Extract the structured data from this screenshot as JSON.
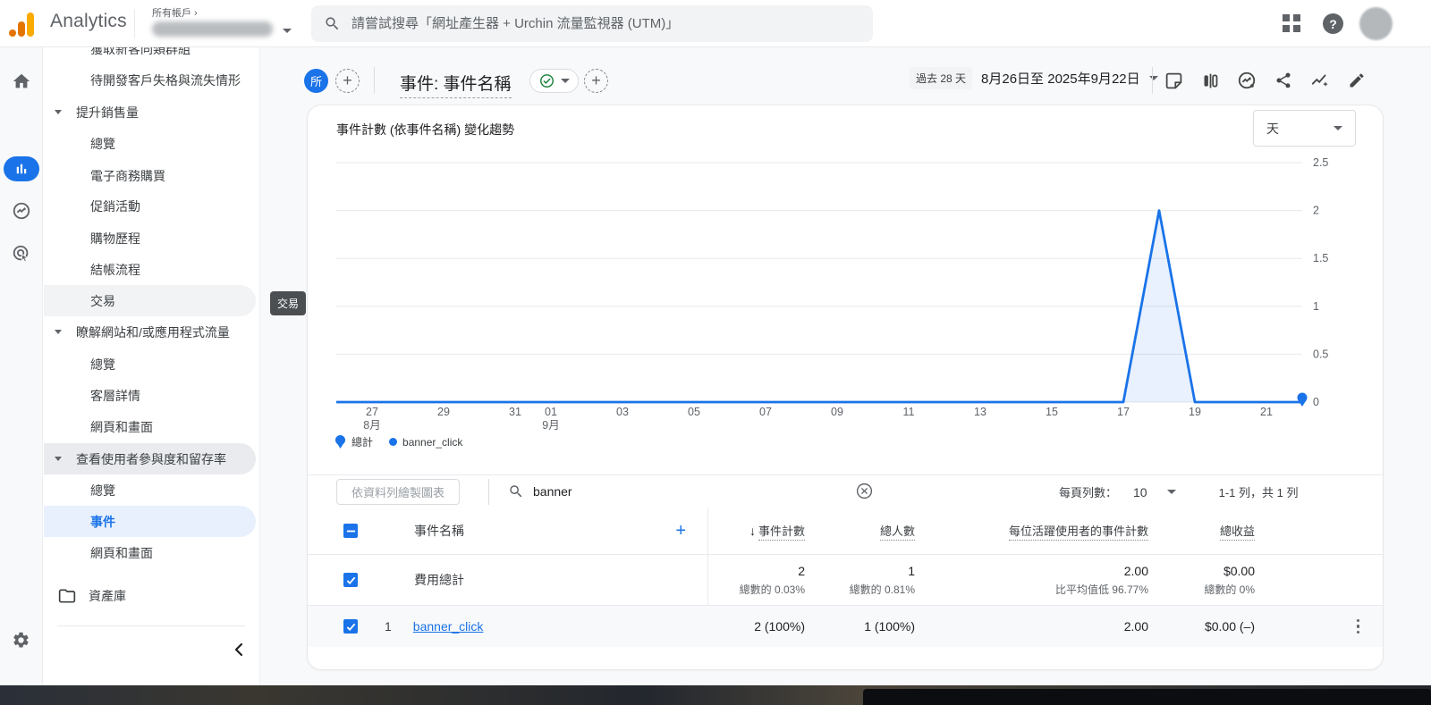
{
  "topbar": {
    "brand": "Analytics",
    "account_breadcrumb": "所有帳戶 ›",
    "search_placeholder": "請嘗試搜尋「網址產生器 + Urchin 流量監視器 (UTM)」",
    "help_glyph": "?"
  },
  "sidebar": {
    "items": [
      {
        "label": "獲取新客同類群組",
        "type": "child"
      },
      {
        "label": "待開發客戶失格與流失情形",
        "type": "child"
      },
      {
        "label": "提升銷售量",
        "type": "group"
      },
      {
        "label": "總覽",
        "type": "child"
      },
      {
        "label": "電子商務購買",
        "type": "child"
      },
      {
        "label": "促銷活動",
        "type": "child"
      },
      {
        "label": "購物歷程",
        "type": "child"
      },
      {
        "label": "結帳流程",
        "type": "child"
      },
      {
        "label": "交易",
        "type": "child",
        "state": "hover"
      },
      {
        "label": "瞭解網站和/或應用程式流量",
        "type": "group"
      },
      {
        "label": "總覽",
        "type": "child"
      },
      {
        "label": "客層詳情",
        "type": "child"
      },
      {
        "label": "網頁和畫面",
        "type": "child"
      },
      {
        "label": "查看使用者參與度和留存率",
        "type": "group",
        "state": "highlight"
      },
      {
        "label": "總覽",
        "type": "child"
      },
      {
        "label": "事件",
        "type": "child",
        "state": "selected"
      },
      {
        "label": "網頁和畫面",
        "type": "child"
      }
    ],
    "library_label": "資產庫",
    "tooltip": "交易"
  },
  "report_header": {
    "segment_chip": "所",
    "add_chip": "+",
    "title": "事件: 事件名稱",
    "date_range_badge": "過去 28 天",
    "date_range": "8月26日至 2025年9月22日"
  },
  "chart": {
    "title": "事件計數 (依事件名稱) 變化趨勢",
    "interval": "天",
    "legend_total": "總計",
    "legend_series": "banner_click"
  },
  "chart_data": {
    "type": "line",
    "title": "事件計數 (依事件名稱) 變化趨勢",
    "interval": "天",
    "x": [
      "8/26",
      "8/27",
      "8/28",
      "8/29",
      "8/30",
      "8/31",
      "9/01",
      "9/02",
      "9/03",
      "9/04",
      "9/05",
      "9/06",
      "9/07",
      "9/08",
      "9/09",
      "9/10",
      "9/11",
      "9/12",
      "9/13",
      "9/14",
      "9/15",
      "9/16",
      "9/17",
      "9/18",
      "9/19",
      "9/20",
      "9/21",
      "9/22"
    ],
    "series": [
      {
        "name": "banner_click",
        "color": "#1a73e8",
        "values": [
          0,
          0,
          0,
          0,
          0,
          0,
          0,
          0,
          0,
          0,
          0,
          0,
          0,
          0,
          0,
          0,
          0,
          0,
          0,
          0,
          0,
          0,
          0,
          2,
          0,
          0,
          0,
          0
        ]
      }
    ],
    "ylim": [
      0,
      2.5
    ],
    "yticks": [
      2.5,
      2,
      1.5,
      1,
      0.5,
      0
    ],
    "x_ticks": [
      {
        "i": 1,
        "label": "27",
        "month": "8月"
      },
      {
        "i": 3,
        "label": "29"
      },
      {
        "i": 5,
        "label": "31"
      },
      {
        "i": 6,
        "label": "01",
        "month": "9月"
      },
      {
        "i": 8,
        "label": "03"
      },
      {
        "i": 10,
        "label": "05"
      },
      {
        "i": 12,
        "label": "07"
      },
      {
        "i": 14,
        "label": "09"
      },
      {
        "i": 16,
        "label": "11"
      },
      {
        "i": 18,
        "label": "13"
      },
      {
        "i": 20,
        "label": "15"
      },
      {
        "i": 22,
        "label": "17"
      },
      {
        "i": 24,
        "label": "19"
      },
      {
        "i": 26,
        "label": "21"
      }
    ],
    "grid": true,
    "legend": [
      "總計",
      "banner_click"
    ],
    "legend_position": "bottom"
  },
  "table": {
    "plot_rows_button": "依資料列繪製圖表",
    "search_value": "banner",
    "rows_per_page_label": "每頁列數：",
    "rows_per_page": "10",
    "pagination": "1-1 列，共 1 列",
    "columns": {
      "dimension": "事件名稱",
      "metric1": "事件計數",
      "metric2": "總人數",
      "metric3": "每位活躍使用者的事件計數",
      "metric4": "總收益"
    },
    "sort_arrow": "↓",
    "totals": {
      "label": "費用總計",
      "event_count": "2",
      "event_count_sub": "總數的 0.03%",
      "total_users": "1",
      "total_users_sub": "總數的 0.81%",
      "count_per_user": "2.00",
      "count_per_user_sub": "比平均值低 96.77%",
      "revenue": "$0.00",
      "revenue_sub": "總數的 0%"
    },
    "rows": [
      {
        "index": "1",
        "name": "banner_click",
        "event_count": "2 (100%)",
        "total_users": "1 (100%)",
        "count_per_user": "2.00",
        "revenue": "$0.00 (–)"
      }
    ]
  }
}
